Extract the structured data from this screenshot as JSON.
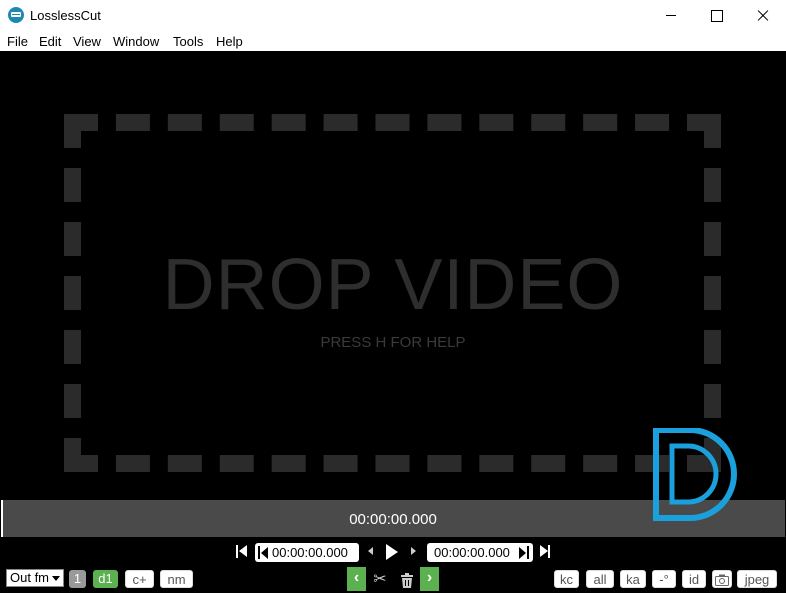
{
  "window": {
    "title": "LosslessCut"
  },
  "menu": {
    "items": [
      "File",
      "Edit",
      "View",
      "Window",
      "Tools",
      "Help"
    ]
  },
  "drop_zone": {
    "title": "DROP VIDEO",
    "hint": "PRESS H FOR HELP"
  },
  "timeline": {
    "current_time": "00:00:00.000",
    "position": 0
  },
  "transport": {
    "cut_start": "00:00:00.000",
    "cut_end": "00:00:00.000"
  },
  "toolbar": {
    "output_format": "Out fm",
    "segment_count": "1",
    "d1_label": "d1",
    "cplus_label": "c+",
    "nm_label": "nm",
    "kc_label": "kc",
    "all_label": "all",
    "ka_label": "ka",
    "rotate_label": "-°",
    "id_label": "id",
    "jpeg_label": "jpeg"
  },
  "colors": {
    "accent_green": "#5bb04f",
    "timeline_bg": "#4a4a4a",
    "logo_blue": "#1aa0dc"
  },
  "icons": [
    "scissors-icon",
    "trash-icon",
    "camera-icon",
    "play-icon"
  ]
}
